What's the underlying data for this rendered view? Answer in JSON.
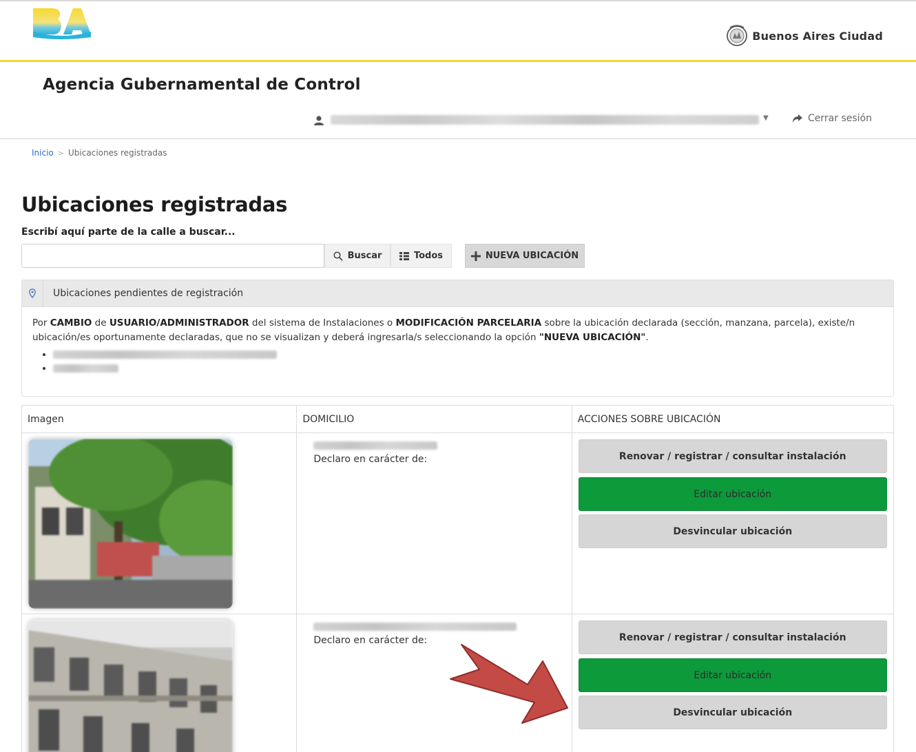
{
  "header": {
    "city_name": "Buenos Aires Ciudad",
    "logo_text": "BA",
    "agency_title": "Agencia Gubernamental de Control",
    "logout_label": "Cerrar sesión"
  },
  "breadcrumb": {
    "home": "Inicio",
    "separator": ">",
    "current": "Ubicaciones registradas"
  },
  "page": {
    "title": "Ubicaciones registradas",
    "search_label": "Escribí aquí parte de la calle a buscar...",
    "search_value": "",
    "buscar_label": "Buscar",
    "todos_label": "Todos",
    "nueva_label": "NUEVA UBICACIÓN"
  },
  "pending": {
    "title": "Ubicaciones pendientes de registración",
    "text_1": "Por ",
    "bold_1": "CAMBIO",
    "text_2": " de ",
    "bold_2": "USUARIO/ADMINISTRADOR",
    "text_3": " del sistema de Instalaciones o ",
    "bold_3": "MODIFICACIÓN PARCELARIA",
    "text_4": " sobre la ubicación declarada (sección, manzana, parcela), existe/n ubicación/es oportunamente declaradas, que no se visualizan y deberá ingresarla/s seleccionando la opción ",
    "bold_4": "\"NUEVA UBICACIÓN\"",
    "text_5": "."
  },
  "table": {
    "headers": [
      "Imagen",
      "DOMICILIO",
      "ACCIONES SOBRE UBICACIÓN"
    ],
    "rows": [
      {
        "declaro": "Declaro en carácter de:",
        "btn_renovar": "Renovar / registrar / consultar instalación",
        "btn_editar": "Editar ubicación",
        "btn_desvincular": "Desvincular ubicación"
      },
      {
        "declaro": "Declaro en carácter de:",
        "btn_renovar": "Renovar / registrar / consultar instalación",
        "btn_editar": "Editar ubicación",
        "btn_desvincular": "Desvincular ubicación"
      }
    ]
  },
  "colors": {
    "brand_yellow": "#f2d635",
    "edit_green": "#0c9a3b",
    "arrow_red": "#c44a46",
    "link_blue": "#2a6cc4"
  },
  "icons": {
    "user": "user-icon",
    "logout": "share-arrow-icon",
    "search": "search-icon",
    "todos": "grid-icon",
    "nueva": "plus-icon",
    "panel": "map-pin-icon"
  }
}
